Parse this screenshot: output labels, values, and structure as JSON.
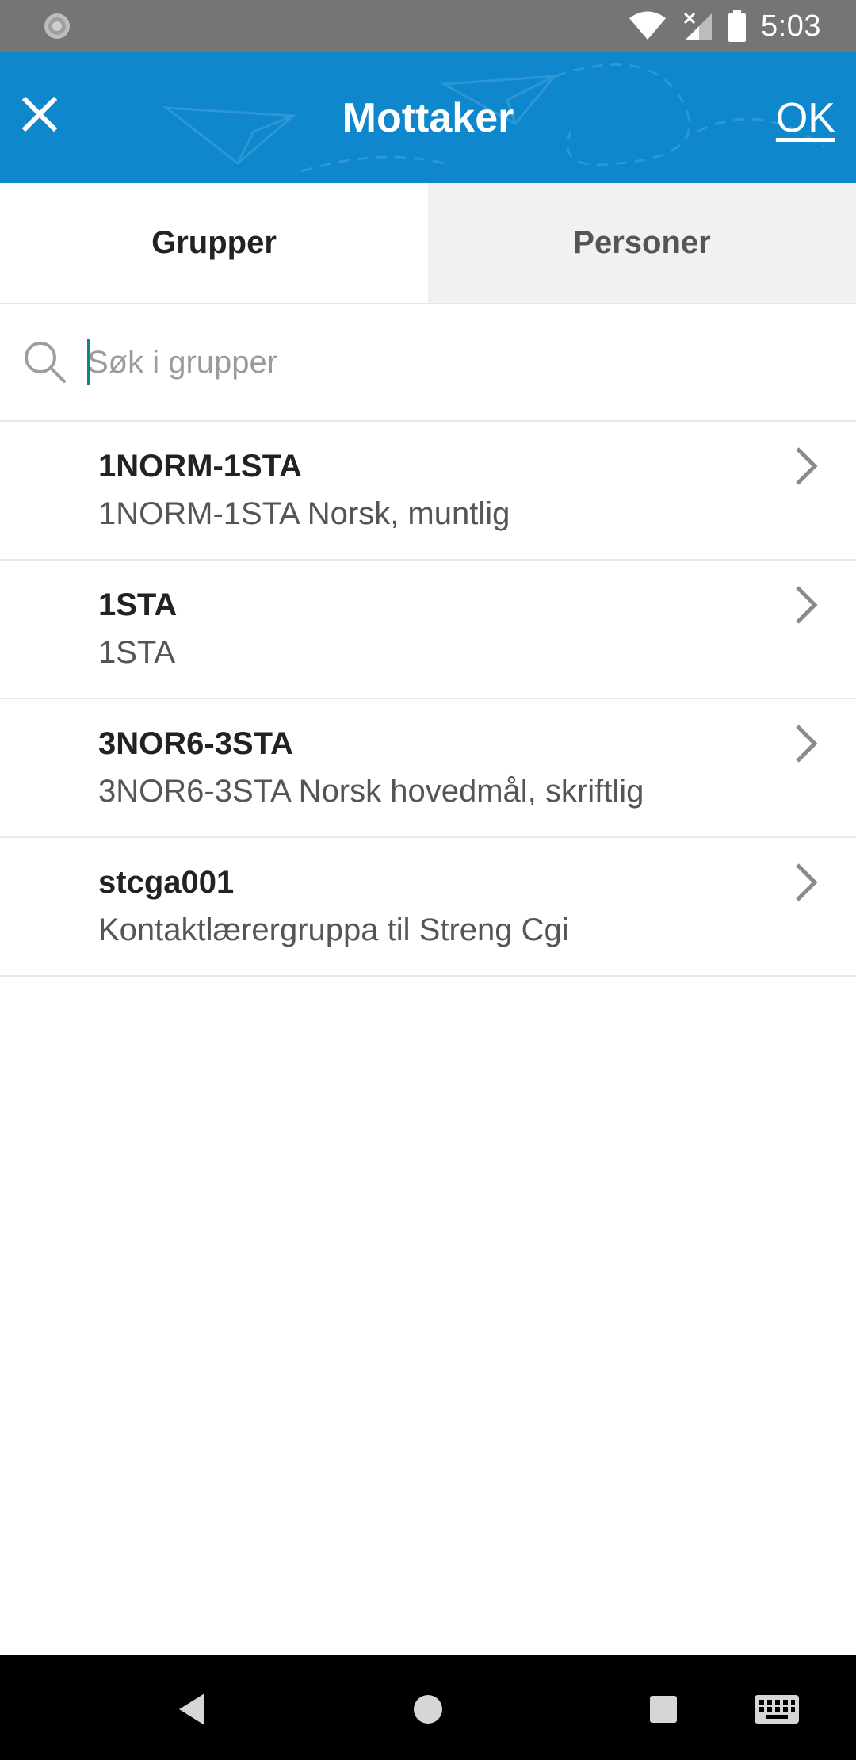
{
  "status_bar": {
    "time": "5:03",
    "icons": [
      "sync-icon",
      "wifi-icon",
      "signal-off-icon",
      "battery-icon"
    ]
  },
  "app_bar": {
    "title": "Mottaker",
    "ok_label": "OK",
    "close_icon": "close-icon",
    "background_color": "#0e87cc"
  },
  "tabs": [
    {
      "label": "Grupper",
      "selected": true
    },
    {
      "label": "Personer",
      "selected": false
    }
  ],
  "search": {
    "placeholder": "Søk i grupper",
    "value": ""
  },
  "groups": [
    {
      "name": "1NORM-1STA",
      "description": "1NORM-1STA Norsk, muntlig"
    },
    {
      "name": "1STA",
      "description": "1STA"
    },
    {
      "name": "3NOR6-3STA",
      "description": "3NOR6-3STA Norsk hovedmål, skriftlig"
    },
    {
      "name": "stcga001",
      "description": "Kontaktlærergruppa til Streng Cgi"
    }
  ],
  "nav_bar": {
    "icons": [
      "back-icon",
      "home-icon",
      "recents-icon",
      "keyboard-icon"
    ]
  }
}
